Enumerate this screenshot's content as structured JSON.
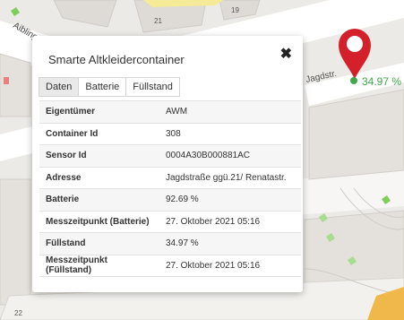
{
  "map": {
    "street_label": "Jagdstr.",
    "street_label_2": "Aiblinger",
    "house_numbers": [
      "21",
      "19",
      "22"
    ],
    "fill_level_label": "34.97 %"
  },
  "popup": {
    "title": "Smarte Altkleidercontainer",
    "close_glyph": "✖",
    "tabs": [
      "Daten",
      "Batterie",
      "Füllstand"
    ],
    "active_tab": "Daten",
    "rows": [
      {
        "key": "Eigentümer",
        "value": "AWM"
      },
      {
        "key": "Container Id",
        "value": "308"
      },
      {
        "key": "Sensor Id",
        "value": "0004A30B000881AC"
      },
      {
        "key": "Adresse",
        "value": "Jagdstraße ggü.21/ Renatastr."
      },
      {
        "key": "Batterie",
        "value": "92.69 %"
      },
      {
        "key": "Messzeitpunkt (Batterie)",
        "value": "27. Oktober 2021 05:16"
      },
      {
        "key": "Füllstand",
        "value": "34.97 %"
      },
      {
        "key": "Messzeitpunkt (Füllstand)",
        "value": "27. Oktober 2021 05:16"
      }
    ]
  },
  "colors": {
    "marker_red": "#d4202a",
    "fill_green": "#3ea84a",
    "map_bg": "#eceae6",
    "building": "#dedbd6",
    "street": "#ffffff",
    "grass": "#7dcf5a"
  }
}
